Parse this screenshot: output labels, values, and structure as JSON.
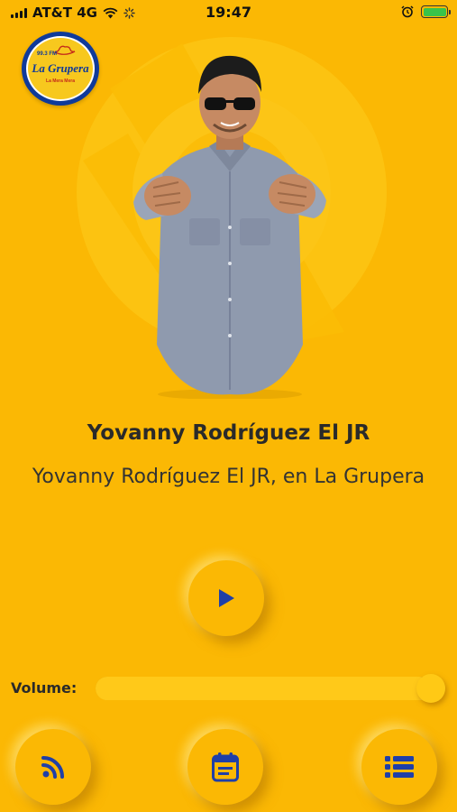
{
  "status_bar": {
    "carrier": "AT&T 4G",
    "time": "19:47"
  },
  "logo": {
    "frequency": "99.3 FM",
    "name": "La Grupera",
    "tagline": "La Mera Mera"
  },
  "now_playing": {
    "title": "Yovanny Rodríguez El JR",
    "subtitle": "Yovanny Rodríguez El JR, en La Grupera"
  },
  "controls": {
    "play_icon": "play-icon",
    "volume_label": "Volume:",
    "volume_level": 0.96
  },
  "bottom_nav": {
    "rss_icon": "rss-icon",
    "calendar_icon": "calendar-icon",
    "list_icon": "list-icon"
  },
  "colors": {
    "background": "#fbb804",
    "accent": "#1f3fa8",
    "text": "#2a2a2a"
  }
}
